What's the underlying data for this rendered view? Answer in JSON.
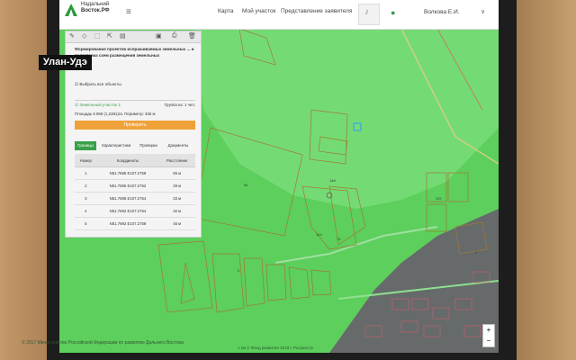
{
  "caption": "Улан-Удэ",
  "header": {
    "logo_line1": "Надальний",
    "logo_line2": "Восток.РФ",
    "nav": [
      "Карта",
      "Мой участок",
      "Представление заявителя"
    ],
    "user_name": "Волкова Е.И."
  },
  "panel": {
    "title": "Формирование проектов испрашиваемых земельных ... и подготовка схем размещения земельных",
    "select_all": "Выбрать все объекты",
    "parcel_name": "Земельный участок 1",
    "parcel_group": "Группа из: 1 чел.",
    "parcel_area": "Площадь 6 869 (1,2281)га. Периметр: 345 м",
    "parcel_button": "Проверить",
    "tabs": [
      "Границы",
      "Характеристики",
      "Проверки",
      "Документы"
    ],
    "table": {
      "headers": [
        "Номер",
        "Координаты",
        "Расстояние"
      ],
      "rows": [
        [
          "1",
          "N51.7695 E107.2758",
          "55 м"
        ],
        [
          "2",
          "N51.7695 E107.2762",
          "29 м"
        ],
        [
          "3",
          "N51.7695 E107.2764",
          "33 м"
        ],
        [
          "4",
          "N51.7692 E107.2764",
          "32 м"
        ],
        [
          "5",
          "N51.7692 E107.2758",
          "45 м"
        ]
      ]
    }
  },
  "footer": {
    "copyright": "© 2017 Министерство Российской Федерации по развитию Дальнего Востока",
    "scale": "1 км © Фонд развития 2018 г. Росреестр"
  },
  "map_labels": [
    "96",
    "104",
    "79",
    "148",
    "137",
    "1",
    "2"
  ],
  "colors": {
    "map_green": "#5ccf5c",
    "parcel_dark": "#7fe07f",
    "accent": "#3aa04a",
    "button": "#f0a23a",
    "urban": "#666a6a"
  }
}
